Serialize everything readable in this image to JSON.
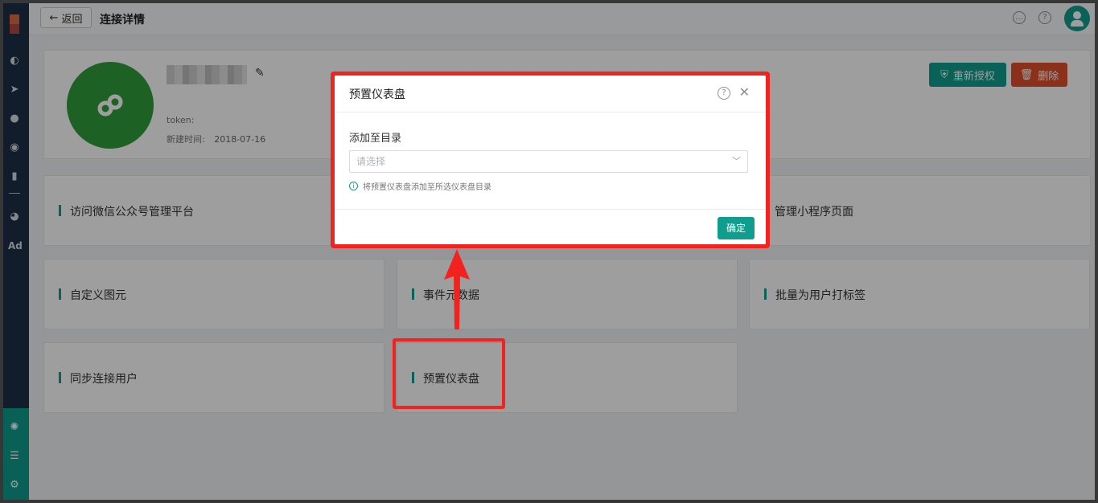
{
  "header": {
    "back_label": "返回",
    "title": "连接详情"
  },
  "app_info": {
    "token_label": "token:",
    "created_label": "新建时间:",
    "created_value": "2018-07-16",
    "reauth_label": "重新授权",
    "delete_label": "删除"
  },
  "cards": [
    {
      "label": "访问微信公众号管理平台"
    },
    {
      "label": "管理小程序页面"
    },
    {
      "label": "自定义图元"
    },
    {
      "label": "事件元数据"
    },
    {
      "label": "批量为用户打标签"
    },
    {
      "label": "同步连接用户"
    },
    {
      "label": "预置仪表盘"
    }
  ],
  "sidebar": {
    "ad_label": "Ad"
  },
  "modal": {
    "title": "预置仪表盘",
    "field_label": "添加至目录",
    "select_placeholder": "请选择",
    "hint": "将预置仪表盘添加至所选仪表盘目录",
    "confirm_label": "确定"
  },
  "colors": {
    "accent": "#0f9d8d",
    "danger": "#e0502d",
    "annotation": "#f2231f",
    "sidebar": "#1e2f47"
  }
}
